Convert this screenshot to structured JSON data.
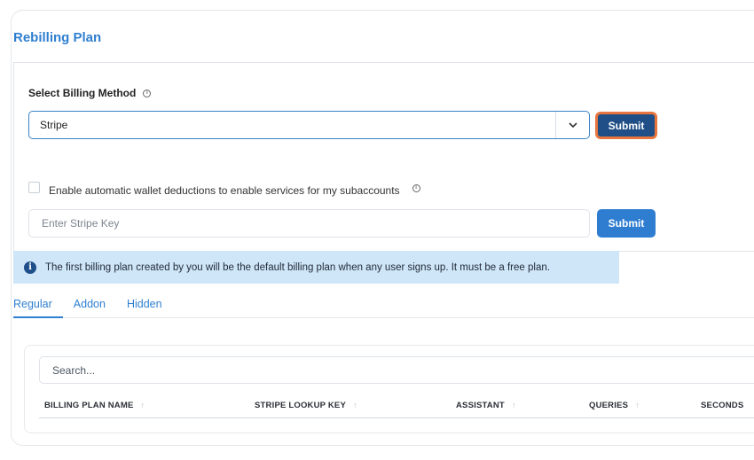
{
  "page": {
    "title": "Rebilling Plan"
  },
  "billing_method": {
    "label": "Select Billing Method",
    "info_icon": "info-circle-icon",
    "selected": "Stripe",
    "submit_label": "Submit"
  },
  "wallet": {
    "checkbox_label": "Enable automatic wallet deductions to enable services for my subaccounts",
    "checked": false,
    "key_placeholder": "Enter Stripe Key",
    "submit_label": "Submit"
  },
  "notice": {
    "icon": "info-filled-icon",
    "text": "The first billing plan created by you will be the default billing plan when any user signs up. It must be a free plan."
  },
  "tabs": [
    {
      "label": "Regular",
      "active": true
    },
    {
      "label": "Addon",
      "active": false
    },
    {
      "label": "Hidden",
      "active": false
    }
  ],
  "table": {
    "search_placeholder": "Search...",
    "columns": [
      {
        "label": "BILLING PLAN NAME"
      },
      {
        "label": "STRIPE LOOKUP KEY"
      },
      {
        "label": "ASSISTANT"
      },
      {
        "label": "QUERIES"
      },
      {
        "label": "SECONDS"
      }
    ],
    "sort_glyph": "↑"
  },
  "colors": {
    "accent": "#2f7fd0",
    "submit_dark": "#1f4f86",
    "focus_ring": "#e8753d",
    "notice_bg": "#cfe6f8"
  }
}
